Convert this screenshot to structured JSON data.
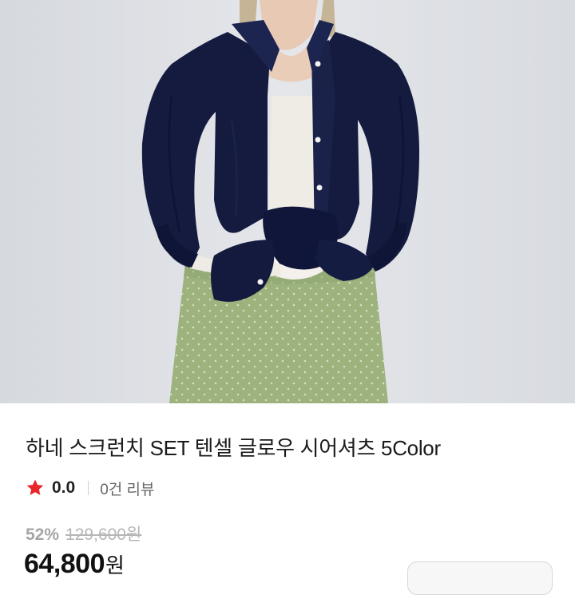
{
  "product": {
    "title": "하네 스크런치 SET 텐셀 글로우 시어셔츠 5Color",
    "rating": {
      "icon": "star-icon",
      "value": "0.0",
      "review_count": "0건 리뷰"
    },
    "price": {
      "discount_rate": "52%",
      "original_price": "129,600원",
      "sale_price": "64,800",
      "currency_unit": "원"
    }
  },
  "colors": {
    "star": "#e8262b",
    "shirt": "#141b3f",
    "skirt": "#9bb07a",
    "background": "#dfe2e7"
  }
}
